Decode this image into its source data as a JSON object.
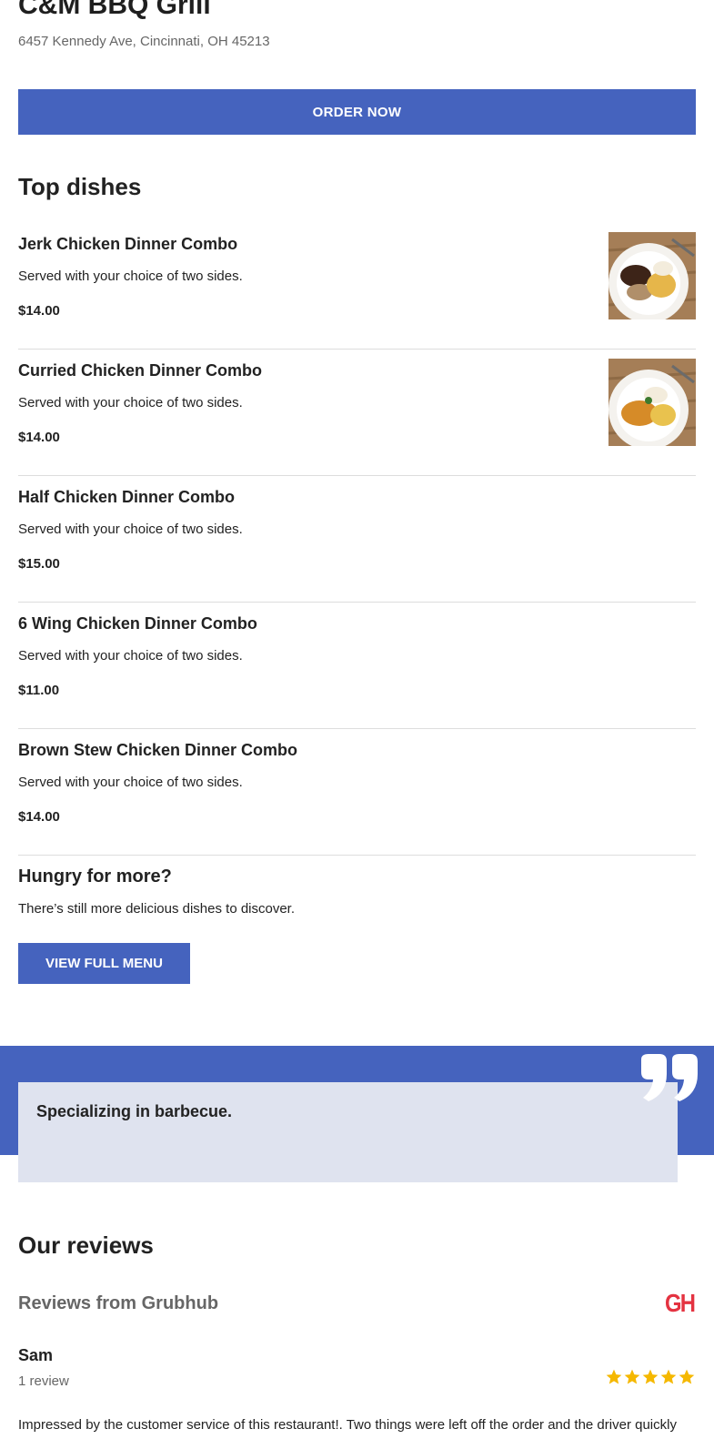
{
  "restaurant": {
    "name": "C&M BBQ Grill",
    "address": "6457 Kennedy Ave, Cincinnati, OH 45213"
  },
  "order_button": "ORDER NOW",
  "top_dishes": {
    "title": "Top dishes",
    "items": [
      {
        "name": "Jerk Chicken Dinner Combo",
        "description": "Served with your choice of two sides.",
        "price": "$14.00",
        "has_image": true
      },
      {
        "name": "Curried Chicken Dinner Combo",
        "description": "Served with your choice of two sides.",
        "price": "$14.00",
        "has_image": true
      },
      {
        "name": "Half Chicken Dinner Combo",
        "description": "Served with your choice of two sides.",
        "price": "$15.00",
        "has_image": false
      },
      {
        "name": "6 Wing Chicken Dinner Combo",
        "description": "Served with your choice of two sides.",
        "price": "$11.00",
        "has_image": false
      },
      {
        "name": "Brown Stew Chicken Dinner Combo",
        "description": "Served with your choice of two sides.",
        "price": "$14.00",
        "has_image": false
      }
    ]
  },
  "more": {
    "title": "Hungry for more?",
    "text": "There’s still more delicious dishes to discover.",
    "button": "VIEW FULL MENU"
  },
  "quote": {
    "text": "Specializing in barbecue."
  },
  "reviews": {
    "title": "Our reviews",
    "source": "Reviews from Grubhub",
    "source_logo": "GH",
    "items": [
      {
        "name": "Sam",
        "count": "1 review",
        "rating": 5,
        "text": "Impressed by the customer service of this restaurant!. Two things were left off the order and the driver quickly"
      }
    ]
  },
  "colors": {
    "accent": "#4563be",
    "quote_card": "#dfe3ef",
    "star": "#f5b800",
    "grubhub": "#e43341"
  }
}
